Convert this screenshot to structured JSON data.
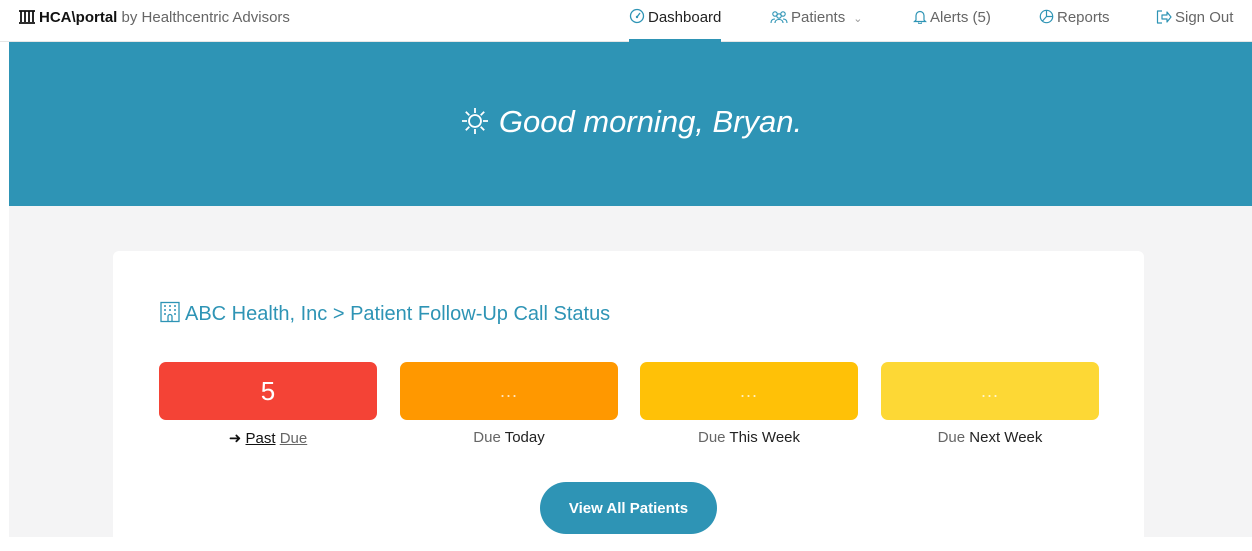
{
  "brand": {
    "name": "HCA\\portal",
    "by": "by Healthcentric Advisors",
    "icon": "columns-icon"
  },
  "nav": {
    "dashboard": {
      "label": "Dashboard",
      "icon": "dashboard-gauge-icon"
    },
    "patients": {
      "label": "Patients",
      "icon": "people-icon"
    },
    "alerts": {
      "label": "Alerts (5)",
      "icon": "bell-icon"
    },
    "reports": {
      "label": "Reports",
      "icon": "pie-chart-icon"
    },
    "sign_out": {
      "label": "Sign Out",
      "icon": "sign-out-icon"
    }
  },
  "hero": {
    "greeting": "Good morning, Bryan.",
    "icon": "sun-icon"
  },
  "card": {
    "title": "ABC Health, Inc > Patient Follow-Up Call Status",
    "icon": "building-icon"
  },
  "status": {
    "past_due": {
      "value": "5",
      "prefix": "Past",
      "suffix": "Due"
    },
    "today": {
      "value": "...",
      "prefix": "Due",
      "suffix": "Today"
    },
    "this_week": {
      "value": "...",
      "prefix": "Due",
      "suffix": "This Week"
    },
    "next_week": {
      "value": "...",
      "prefix": "Due",
      "suffix": "Next Week"
    }
  },
  "actions": {
    "view_all": "View All Patients"
  },
  "colors": {
    "accent": "#2e94b5",
    "past_due": "#f44336",
    "today": "#ff9800",
    "this_week": "#ffc107",
    "next_week": "#fdd835"
  }
}
